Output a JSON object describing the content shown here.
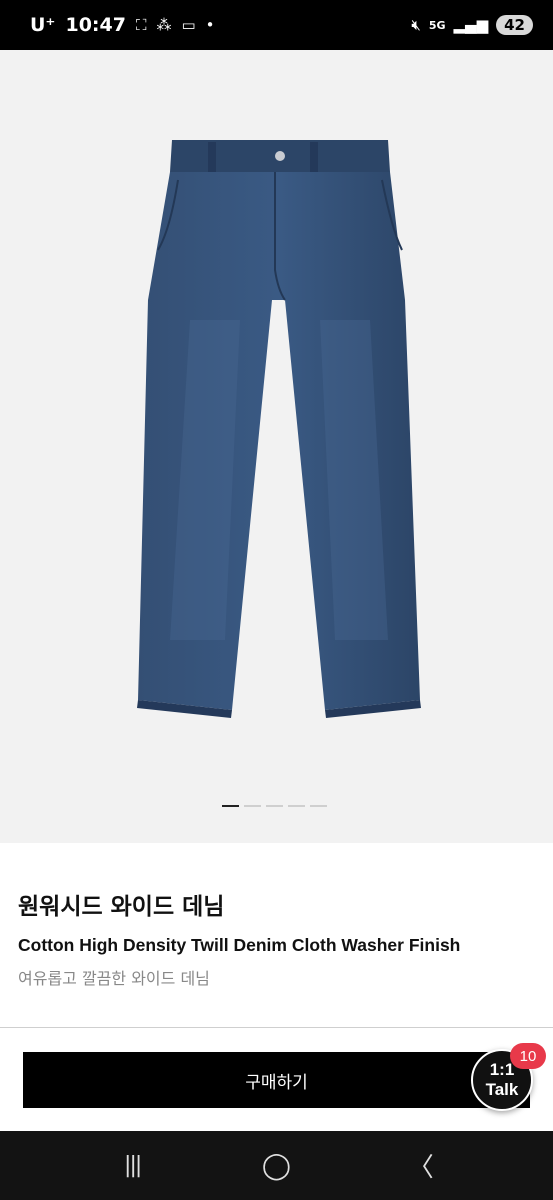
{
  "status_bar": {
    "carrier": "U⁺",
    "time": "10:47",
    "icons_left": [
      "screenshot-icon",
      "app-icon",
      "voicemail-icon",
      "dot-icon"
    ],
    "network": "5G",
    "battery": "42"
  },
  "gallery": {
    "image_count": 5,
    "active_index": 0,
    "denim_color": "#2f4a70"
  },
  "product": {
    "title": "원워시드 와이드 데님",
    "subtitle": "Cotton High Density Twill Denim Cloth Washer Finish",
    "description": "여유롭고 깔끔한 와이드 데님"
  },
  "actions": {
    "buy_label": "구매하기",
    "talk_line1": "1:1",
    "talk_line2": "Talk",
    "talk_badge": "10"
  },
  "nav": {
    "recents": "|||",
    "home": "◯",
    "back": "〈"
  },
  "colors": {
    "badge": "#e8394a",
    "button": "#000000"
  }
}
